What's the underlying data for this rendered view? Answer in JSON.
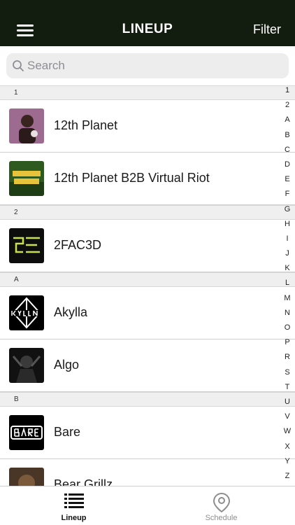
{
  "header": {
    "title": "LINEUP",
    "filter_label": "Filter"
  },
  "search": {
    "placeholder": "Search"
  },
  "sections": [
    {
      "letter": "1",
      "artists": [
        "12th Planet",
        "12th Planet B2B Virtual Riot"
      ]
    },
    {
      "letter": "2",
      "artists": [
        "2FAC3D"
      ]
    },
    {
      "letter": "A",
      "artists": [
        "Akylla",
        "Algo"
      ]
    },
    {
      "letter": "B",
      "artists": [
        "Bare",
        "Bear Grillz"
      ]
    }
  ],
  "index_letters": [
    "1",
    "2",
    "A",
    "B",
    "C",
    "D",
    "E",
    "F",
    "G",
    "H",
    "I",
    "J",
    "K",
    "L",
    "M",
    "N",
    "O",
    "P",
    "R",
    "S",
    "T",
    "U",
    "V",
    "W",
    "X",
    "Y",
    "Z"
  ],
  "tabs": {
    "lineup": "Lineup",
    "schedule": "Schedule"
  },
  "colors": {
    "header_bg": "#121c0f",
    "section_bg": "#efefef",
    "tab_inactive": "#8e8e8e"
  }
}
